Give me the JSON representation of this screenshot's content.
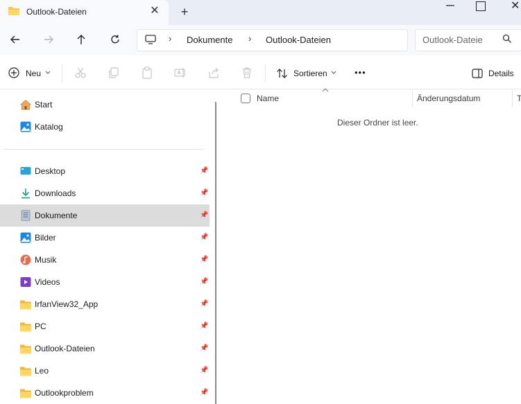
{
  "window": {
    "tab_title": "Outlook-Dateien",
    "tab_close_glyph": "✕",
    "new_tab_glyph": "+",
    "close_glyph": "✕"
  },
  "address": {
    "crumbs": [
      "Dokumente",
      "Outlook-Dateien"
    ],
    "separator": "›",
    "search_placeholder": "Outlook-Dateie"
  },
  "toolbar": {
    "new_label": "Neu",
    "sort_label": "Sortieren",
    "more_label": "•••",
    "details_label": "Details"
  },
  "sidebar": {
    "top_items": [
      {
        "label": "Start",
        "icon": "home-icon"
      },
      {
        "label": "Katalog",
        "icon": "gallery-icon"
      }
    ],
    "pinned_items": [
      {
        "label": "Desktop",
        "icon": "desktop-icon"
      },
      {
        "label": "Downloads",
        "icon": "download-icon"
      },
      {
        "label": "Dokumente",
        "icon": "documents-icon",
        "selected": true
      },
      {
        "label": "Bilder",
        "icon": "pictures-icon"
      },
      {
        "label": "Musik",
        "icon": "music-icon"
      },
      {
        "label": "Videos",
        "icon": "videos-icon"
      },
      {
        "label": "IrfanView32_App",
        "icon": "folder-icon"
      },
      {
        "label": "PC",
        "icon": "folder-icon"
      },
      {
        "label": "Outlook-Dateien",
        "icon": "folder-icon"
      },
      {
        "label": "Leo",
        "icon": "folder-icon"
      },
      {
        "label": "Outlookproblem",
        "icon": "folder-icon"
      }
    ]
  },
  "content": {
    "columns": [
      "Name",
      "Änderungsdatum",
      "T"
    ],
    "empty_message": "Dieser Ordner ist leer."
  },
  "colors": {
    "folder": "#f7c64a",
    "selected_bg": "#dcdcdc",
    "titlebar_bg": "#e8edf6"
  }
}
